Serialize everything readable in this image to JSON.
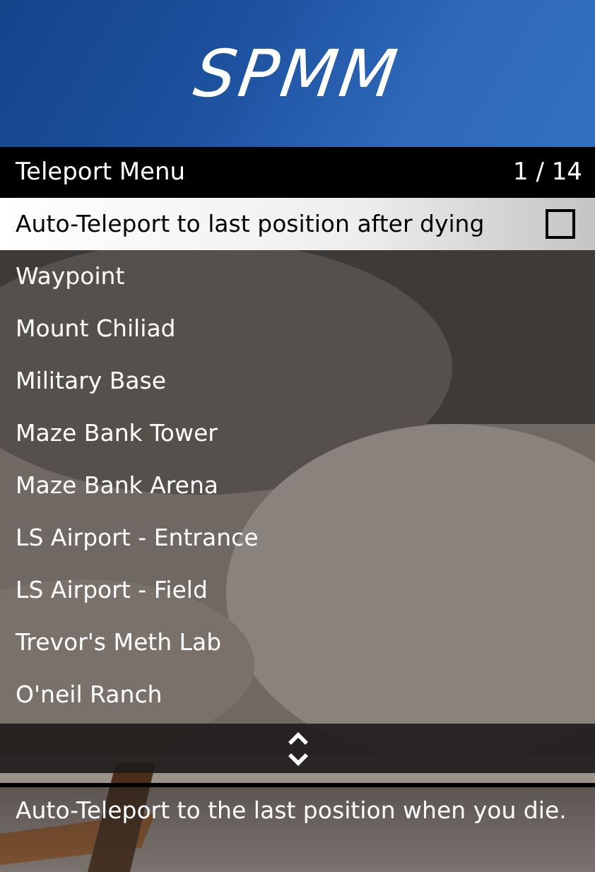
{
  "banner": {
    "title": "SPMM"
  },
  "header": {
    "title": "Teleport Menu",
    "counter": "1 / 14"
  },
  "items": [
    {
      "label": "Auto-Teleport to last position after dying",
      "kind": "checkbox",
      "checked": false,
      "selected": true
    },
    {
      "label": "Waypoint",
      "kind": "action",
      "selected": false
    },
    {
      "label": "Mount Chiliad",
      "kind": "action",
      "selected": false
    },
    {
      "label": "Military Base",
      "kind": "action",
      "selected": false
    },
    {
      "label": "Maze Bank Tower",
      "kind": "action",
      "selected": false
    },
    {
      "label": "Maze Bank Arena",
      "kind": "action",
      "selected": false
    },
    {
      "label": "LS Airport - Entrance",
      "kind": "action",
      "selected": false
    },
    {
      "label": "LS Airport - Field",
      "kind": "action",
      "selected": false
    },
    {
      "label": "Trevor's Meth Lab",
      "kind": "action",
      "selected": false
    },
    {
      "label": "O'neil Ranch",
      "kind": "action",
      "selected": false
    }
  ],
  "description": "Auto-Teleport to the last position when you die."
}
